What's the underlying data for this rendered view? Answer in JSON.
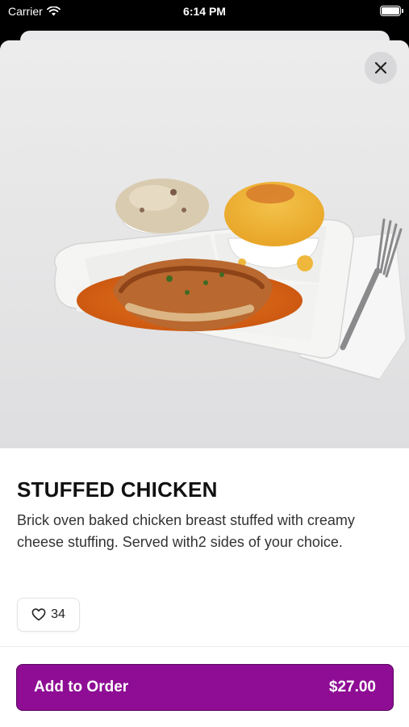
{
  "status_bar": {
    "carrier": "Carrier",
    "time": "6:14 PM"
  },
  "item": {
    "title": "STUFFED CHICKEN",
    "description": "Brick oven baked chicken breast stuffed with creamy cheese stuffing. Served with2 sides of your choice.",
    "likes": "34"
  },
  "order_button": {
    "label": "Add to Order",
    "price": "$27.00"
  },
  "colors": {
    "accent": "#8e0d94",
    "accent_border": "#5a055e"
  },
  "icons": {
    "close": "close-icon",
    "like": "heart-icon",
    "wifi": "wifi-icon",
    "battery": "battery-icon"
  }
}
